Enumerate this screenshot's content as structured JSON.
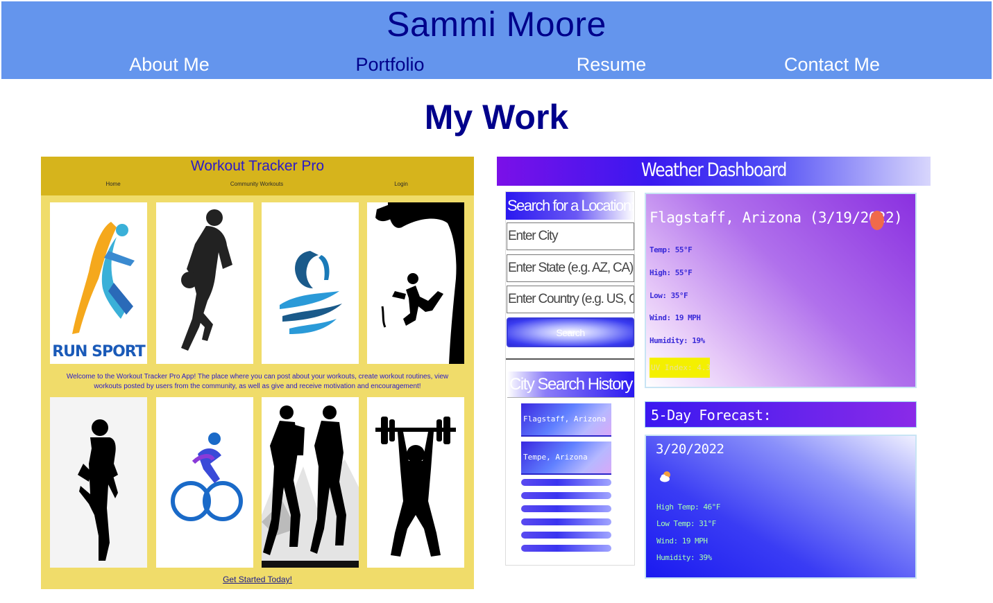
{
  "header": {
    "name": "Sammi Moore",
    "nav": [
      {
        "label": "About Me"
      },
      {
        "label": "Portfolio",
        "active": true
      },
      {
        "label": "Resume"
      },
      {
        "label": "Contact Me"
      }
    ],
    "background": "#6495ed",
    "accent": "#00008b"
  },
  "main": {
    "title": "My Work"
  },
  "workout_tracker": {
    "title": "Workout Tracker Pro",
    "nav": [
      "Home",
      "Community Workouts",
      "Login"
    ],
    "card_images": [
      {
        "name": "run-sport-logo",
        "caption": "RUN SPORT"
      },
      {
        "name": "basketball-player-silhouette"
      },
      {
        "name": "swimmer-logo"
      },
      {
        "name": "rock-climber-silhouette"
      },
      {
        "name": "yoga-pose-silhouette"
      },
      {
        "name": "cyclist-icon"
      },
      {
        "name": "hikers-silhouette"
      },
      {
        "name": "weightlifter-silhouette"
      }
    ],
    "welcome": "Welcome to the Workout Tracker Pro App! The place where you can post about your workouts, create workout routines, view workouts posted by users from the community, as well as give and receive motivation and encouragement!",
    "cta": "Get Started Today!",
    "colors": {
      "header": "#d6b41c",
      "body": "#f0dc6a",
      "title": "#2a1ac8"
    }
  },
  "weather_dashboard": {
    "title": "Weather Dashboard",
    "search_label": "Search for a Location:",
    "inputs": [
      {
        "placeholder": "Enter City"
      },
      {
        "placeholder": "Enter State (e.g. AZ, CA)"
      },
      {
        "placeholder": "Enter Country (e.g. US, GB)"
      }
    ],
    "search_button": "Search",
    "history_label": "City Search History",
    "history": [
      "Flagstaff, Arizona",
      "Tempe, Arizona"
    ],
    "current": {
      "city": "Flagstaff, Arizona (3/19/2022)",
      "temp": "Temp: 55°F",
      "high": "High: 55°F",
      "low": "Low: 35°F",
      "wind": "Wind: 19 MPH",
      "humidity": "Humidity: 19%",
      "uv": "UV Index: 4.33"
    },
    "forecast_label": "5-Day Forecast:",
    "forecast": [
      {
        "date": "3/20/2022",
        "icon": "partly-cloudy-icon",
        "high": "High Temp: 46°F",
        "low": "Low Temp: 31°F",
        "wind": "Wind: 19 MPH",
        "humidity": "Humidity: 39%"
      }
    ]
  }
}
